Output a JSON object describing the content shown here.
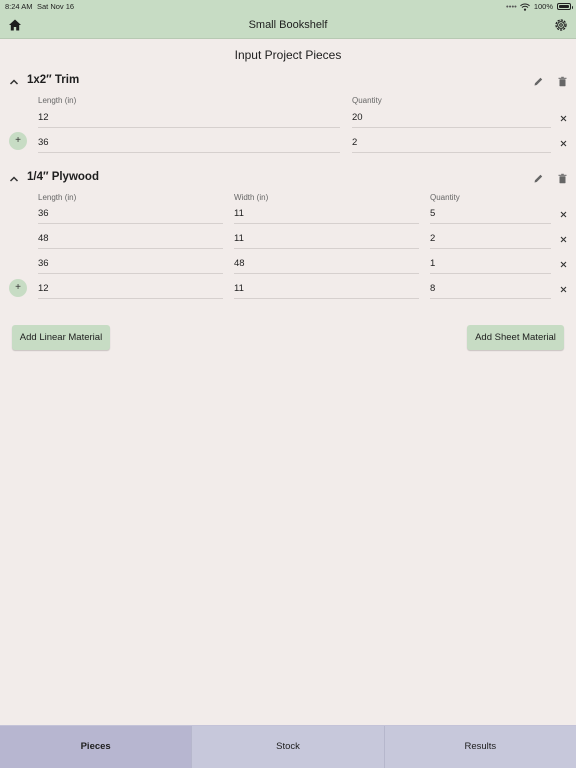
{
  "status_bar": {
    "time": "8:24 AM",
    "date": "Sat Nov 16",
    "battery": "100%"
  },
  "nav": {
    "title": "Small Bookshelf",
    "home_icon": "home-icon",
    "settings_icon": "gear-icon"
  },
  "page": {
    "heading": "Input Project Pieces"
  },
  "sections": [
    {
      "title": "1x2″ Trim",
      "columns": [
        "Length (in)",
        "Quantity"
      ],
      "rows": [
        {
          "length": "12",
          "quantity": "20"
        },
        {
          "length": "36",
          "quantity": "2"
        }
      ]
    },
    {
      "title": "1/4″ Plywood",
      "columns": [
        "Length (in)",
        "Width (in)",
        "Quantity"
      ],
      "rows": [
        {
          "length": "36",
          "width": "11",
          "quantity": "5"
        },
        {
          "length": "48",
          "width": "11",
          "quantity": "2"
        },
        {
          "length": "36",
          "width": "48",
          "quantity": "1"
        },
        {
          "length": "12",
          "width": "11",
          "quantity": "8"
        }
      ]
    }
  ],
  "add_row_label": "+",
  "actions": {
    "add_linear": "Add Linear Material",
    "add_sheet": "Add Sheet Material"
  },
  "tabs": [
    {
      "label": "Pieces",
      "active": true
    },
    {
      "label": "Stock",
      "active": false
    },
    {
      "label": "Results",
      "active": false
    }
  ],
  "colors": {
    "accent": "#c7dcc4",
    "background": "#f2ecea",
    "tab_bar": "#c7c8db",
    "tab_active": "#b7b6d0"
  }
}
